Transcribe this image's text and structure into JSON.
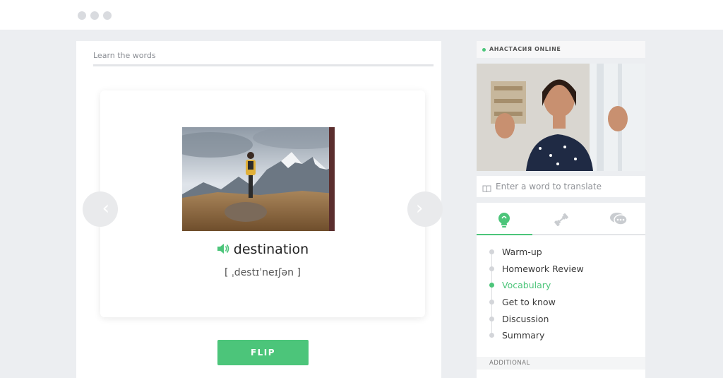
{
  "lesson": {
    "section_title": "Learn the words",
    "card": {
      "image_icon": "mountain-hiker-photo",
      "word": "destination",
      "transcription": "[ ˌdestɪˈneɪʃən ]",
      "prev_icon": "chevron-left-icon",
      "next_icon": "chevron-right-icon",
      "speaker_icon": "speaker-icon"
    },
    "flip_label": "FLIP"
  },
  "teacher": {
    "status": "АНАСТАСИЯ ONLINE",
    "status_color": "#4cc57a",
    "video_icon": "teacher-video"
  },
  "translate": {
    "placeholder": "Enter a word to translate",
    "icon": "book-icon"
  },
  "tabs": [
    {
      "icon": "lightbulb-icon",
      "active": true
    },
    {
      "icon": "dumbbell-icon",
      "active": false
    },
    {
      "icon": "chat-bubbles-icon",
      "active": false
    }
  ],
  "steps": [
    {
      "label": "Warm-up"
    },
    {
      "label": "Homework Review"
    },
    {
      "label": "Vocabulary"
    },
    {
      "label": "Get to know"
    },
    {
      "label": "Discussion"
    },
    {
      "label": "Summary"
    }
  ],
  "active_step": "Vocabulary",
  "additional_label": "ADDITIONAL",
  "colors": {
    "accent": "#4cc57a",
    "background": "#eceef1"
  }
}
